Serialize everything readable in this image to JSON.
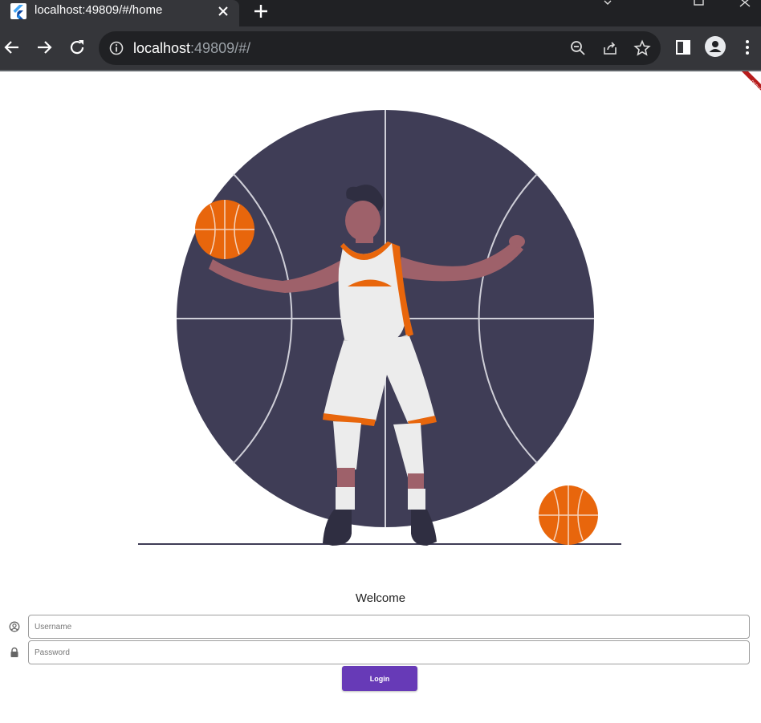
{
  "browser": {
    "tab": {
      "title": "localhost:49809/#/home",
      "favicon": "flutter-logo-icon"
    },
    "omnibox": {
      "host": "localhost",
      "rest": ":49809/#/"
    },
    "icons": {
      "back": "arrow-left-icon",
      "forward": "arrow-right-icon",
      "reload": "reload-icon",
      "zoom": "zoom-out-icon",
      "share": "share-icon",
      "bookmark": "star-icon",
      "side_panel": "side-panel-icon",
      "profile": "profile-icon",
      "menu": "kebab-menu-icon"
    }
  },
  "page": {
    "banner": "DEBUG",
    "illustration": "basketball-player-illustration",
    "welcome": "Welcome",
    "username": {
      "placeholder": "Username",
      "value": "",
      "icon": "account-circle-icon"
    },
    "password": {
      "placeholder": "Password",
      "value": "",
      "icon": "lock-icon"
    },
    "login_label": "Login"
  },
  "colors": {
    "chrome_dark": "#202124",
    "chrome_tab": "#35363a",
    "court": "#3f3d56",
    "ball": "#e8660c",
    "skin": "#a0616a",
    "button": "#673ab7"
  }
}
